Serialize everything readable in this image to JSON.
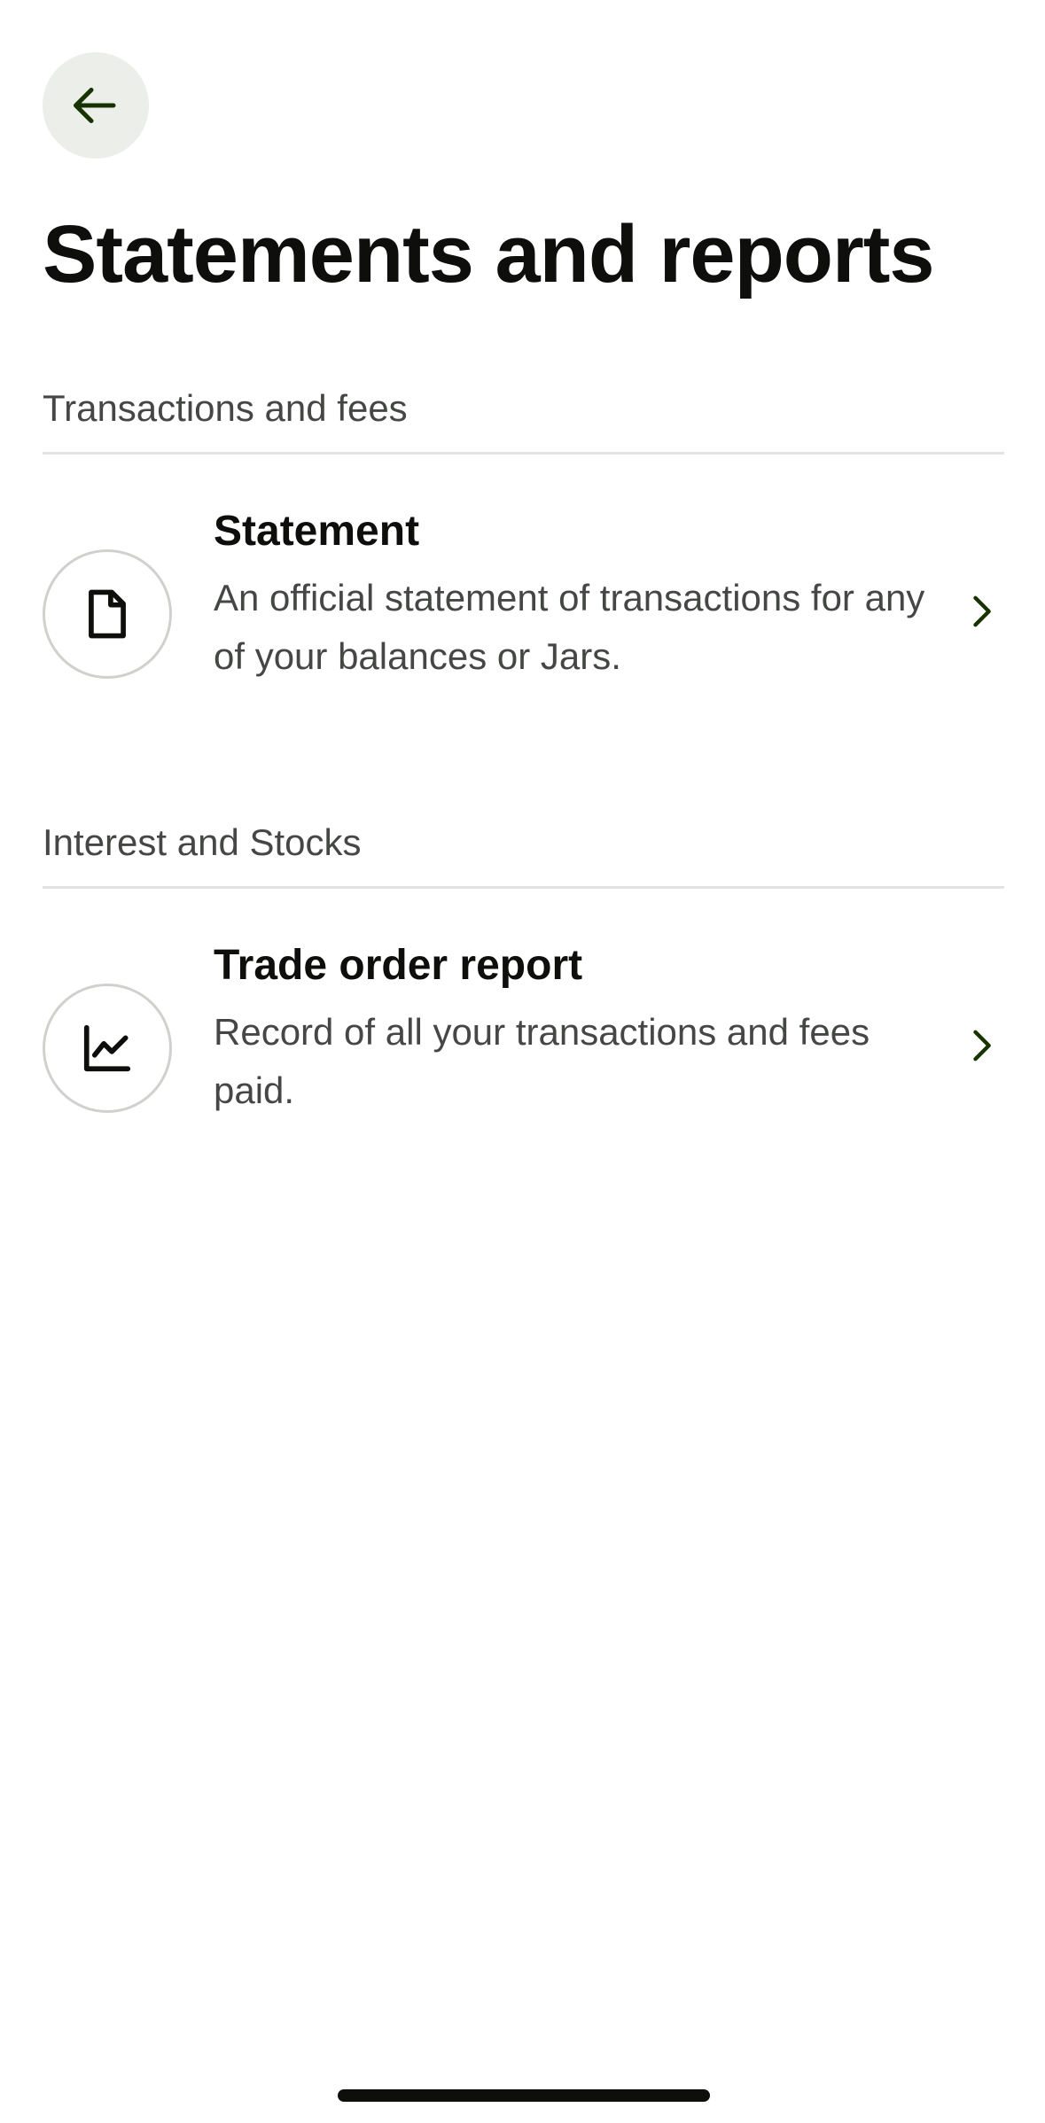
{
  "header": {
    "back_icon": "arrow-left-icon",
    "title": "Statements and reports"
  },
  "sections": [
    {
      "header": "Transactions and fees",
      "items": [
        {
          "icon": "document-icon",
          "title": "Statement",
          "description": "An official statement of transactions for any of your balances or Jars."
        }
      ]
    },
    {
      "header": "Interest and Stocks",
      "items": [
        {
          "icon": "line-chart-icon",
          "title": "Trade order report",
          "description": "Record of all your transactions and fees paid."
        }
      ]
    }
  ],
  "colors": {
    "accent": "#163300",
    "text_primary": "#0e0f0c",
    "text_secondary": "#454745",
    "back_button_bg": "#eceeea",
    "divider": "#e3e4e2"
  }
}
